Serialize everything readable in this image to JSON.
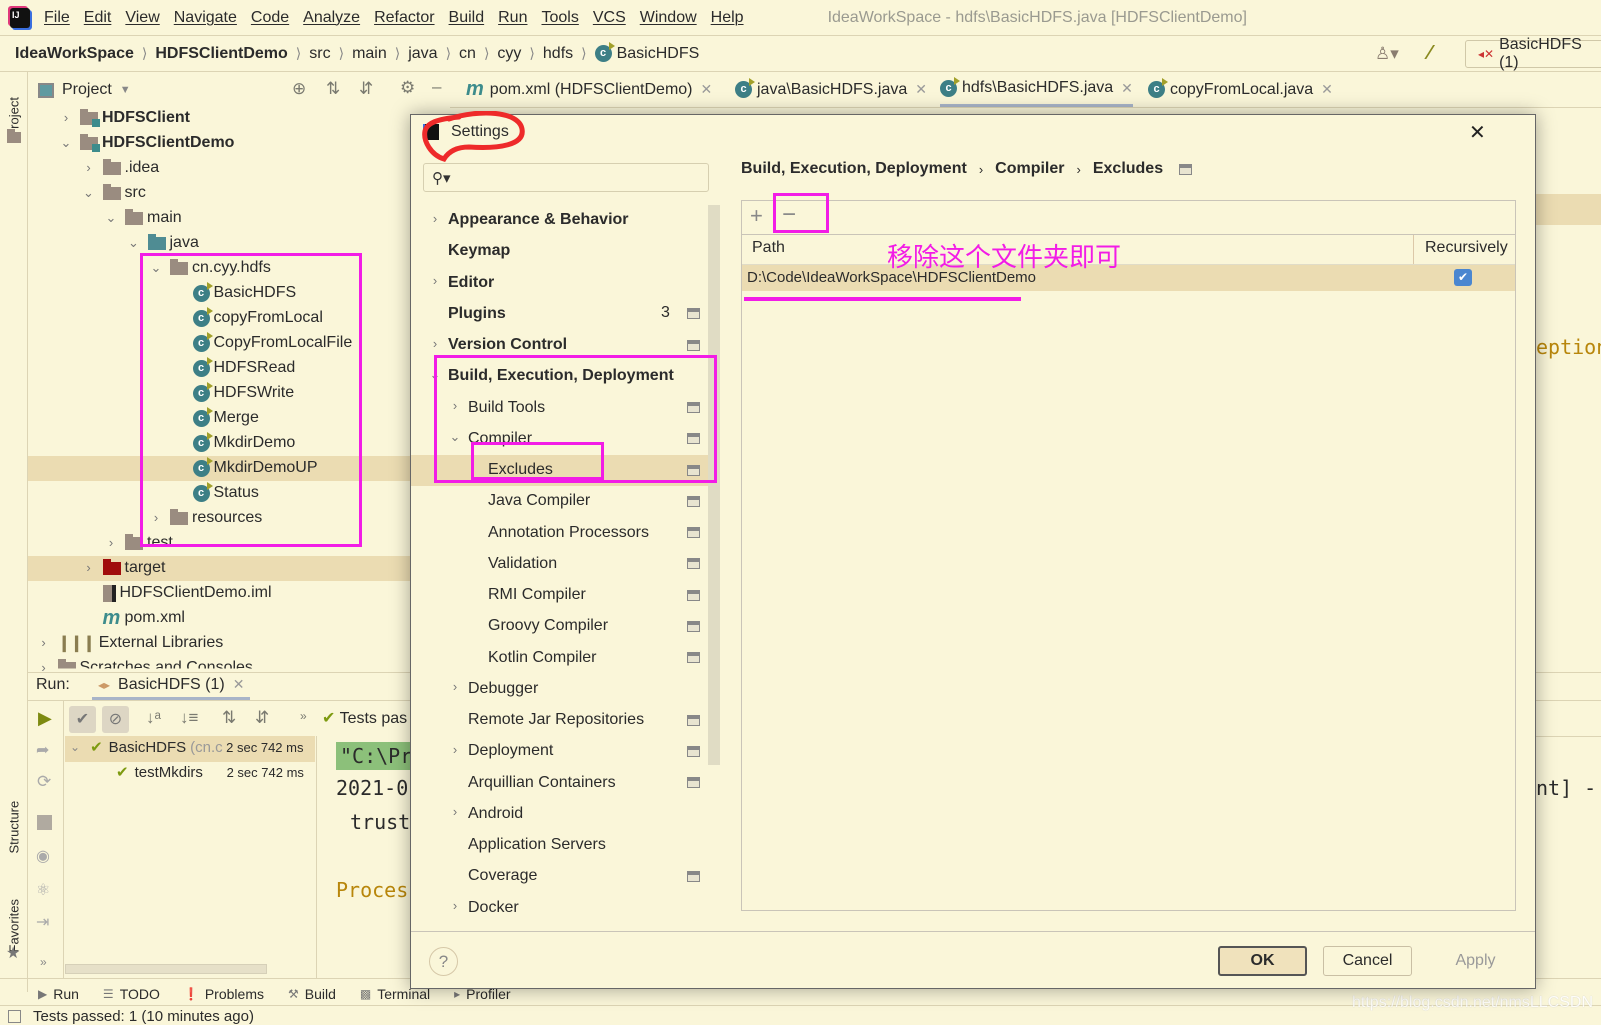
{
  "menubar": {
    "items": [
      "File",
      "Edit",
      "View",
      "Navigate",
      "Code",
      "Analyze",
      "Refactor",
      "Build",
      "Run",
      "Tools",
      "VCS",
      "Window",
      "Help"
    ],
    "window_title": "IdeaWorkSpace - hdfs\\BasicHDFS.java [HDFSClientDemo]"
  },
  "breadcrumb": {
    "items": [
      "IdeaWorkSpace",
      "HDFSClientDemo",
      "src",
      "main",
      "java",
      "cn",
      "cyy",
      "hdfs",
      "BasicHDFS"
    ],
    "run_config": "BasicHDFS (1)"
  },
  "side_stripe": {
    "project": "Project",
    "structure": "Structure",
    "favorites": "Favorites"
  },
  "project_panel": {
    "title": "Project",
    "tree": [
      {
        "label": "HDFSClient",
        "depth": 0,
        "arrow": "right",
        "icon": "module-folder",
        "bold": true
      },
      {
        "label": "HDFSClientDemo",
        "depth": 0,
        "arrow": "down",
        "icon": "module-folder",
        "bold": true
      },
      {
        "label": ".idea",
        "depth": 1,
        "arrow": "right",
        "icon": "folder"
      },
      {
        "label": "src",
        "depth": 1,
        "arrow": "down",
        "icon": "folder"
      },
      {
        "label": "main",
        "depth": 2,
        "arrow": "down",
        "icon": "folder"
      },
      {
        "label": "java",
        "depth": 3,
        "arrow": "down",
        "icon": "source-folder"
      },
      {
        "label": "cn.cyy.hdfs",
        "depth": 4,
        "arrow": "down",
        "icon": "package"
      },
      {
        "label": "BasicHDFS",
        "depth": 5,
        "arrow": "none",
        "icon": "class"
      },
      {
        "label": "copyFromLocal",
        "depth": 5,
        "arrow": "none",
        "icon": "class"
      },
      {
        "label": "CopyFromLocalFile",
        "depth": 5,
        "arrow": "none",
        "icon": "class"
      },
      {
        "label": "HDFSRead",
        "depth": 5,
        "arrow": "none",
        "icon": "class"
      },
      {
        "label": "HDFSWrite",
        "depth": 5,
        "arrow": "none",
        "icon": "class"
      },
      {
        "label": "Merge",
        "depth": 5,
        "arrow": "none",
        "icon": "class"
      },
      {
        "label": "MkdirDemo",
        "depth": 5,
        "arrow": "none",
        "icon": "class"
      },
      {
        "label": "MkdirDemoUP",
        "depth": 5,
        "arrow": "none",
        "icon": "class",
        "selected": true
      },
      {
        "label": "Status",
        "depth": 5,
        "arrow": "none",
        "icon": "class"
      },
      {
        "label": "resources",
        "depth": 4,
        "arrow": "right",
        "icon": "resources-folder"
      },
      {
        "label": "test",
        "depth": 2,
        "arrow": "right",
        "icon": "folder"
      },
      {
        "label": "target",
        "depth": 1,
        "arrow": "right",
        "icon": "excluded-folder",
        "selected": true
      },
      {
        "label": "HDFSClientDemo.iml",
        "depth": 1,
        "arrow": "none",
        "icon": "iml-file"
      },
      {
        "label": "pom.xml",
        "depth": 1,
        "arrow": "none",
        "icon": "maven-file"
      },
      {
        "label": "External Libraries",
        "depth": -1,
        "arrow": "right",
        "icon": "library"
      },
      {
        "label": "Scratches and Consoles",
        "depth": -1,
        "arrow": "right",
        "icon": "scratches"
      }
    ]
  },
  "editor_tabs": [
    {
      "label": "pom.xml (HDFSClientDemo)",
      "icon": "maven"
    },
    {
      "label": "java\\BasicHDFS.java",
      "icon": "class"
    },
    {
      "label": "hdfs\\BasicHDFS.java",
      "icon": "class",
      "active": true
    },
    {
      "label": "copyFromLocal.java",
      "icon": "class"
    }
  ],
  "editor_fragments": {
    "line1": "eption",
    "line2": "nt] -"
  },
  "run_panel": {
    "label": "Run:",
    "tab": "BasicHDFS (1)",
    "status": "Tests pas",
    "tests": [
      {
        "name": "BasicHDFS",
        "suffix": "(cn.c",
        "time": "2 sec 742 ms"
      },
      {
        "name": "testMkdirs",
        "time": "2 sec 742 ms"
      }
    ],
    "console": [
      "\"C:\\Pr",
      "2021-0",
      "trust",
      "Proces"
    ]
  },
  "bottom_tools": [
    "Run",
    "TODO",
    "Problems",
    "Build",
    "Terminal",
    "Profiler"
  ],
  "status_bar": "Tests passed: 1 (10 minutes ago)",
  "watermark": "https://blog.csdn.net/nmsLLCSDN",
  "dialog": {
    "title": "Settings",
    "search_placeholder": "",
    "tree": [
      {
        "label": "Appearance & Behavior",
        "depth": 0,
        "arrow": "right",
        "bold": true
      },
      {
        "label": "Keymap",
        "depth": 0,
        "arrow": "none",
        "bold": true
      },
      {
        "label": "Editor",
        "depth": 0,
        "arrow": "right",
        "bold": true
      },
      {
        "label": "Plugins",
        "depth": 0,
        "arrow": "none",
        "bold": true,
        "badge": "3",
        "project_icon": true
      },
      {
        "label": "Version Control",
        "depth": 0,
        "arrow": "right",
        "bold": true,
        "project_icon": true
      },
      {
        "label": "Build, Execution, Deployment",
        "depth": 0,
        "arrow": "down",
        "bold": true
      },
      {
        "label": "Build Tools",
        "depth": 1,
        "arrow": "right",
        "project_icon": true
      },
      {
        "label": "Compiler",
        "depth": 1,
        "arrow": "down",
        "project_icon": true
      },
      {
        "label": "Excludes",
        "depth": 2,
        "arrow": "none",
        "project_icon": true,
        "selected": true
      },
      {
        "label": "Java Compiler",
        "depth": 2,
        "arrow": "none",
        "project_icon": true
      },
      {
        "label": "Annotation Processors",
        "depth": 2,
        "arrow": "none",
        "project_icon": true
      },
      {
        "label": "Validation",
        "depth": 2,
        "arrow": "none",
        "project_icon": true
      },
      {
        "label": "RMI Compiler",
        "depth": 2,
        "arrow": "none",
        "project_icon": true
      },
      {
        "label": "Groovy Compiler",
        "depth": 2,
        "arrow": "none",
        "project_icon": true
      },
      {
        "label": "Kotlin Compiler",
        "depth": 2,
        "arrow": "none",
        "project_icon": true
      },
      {
        "label": "Debugger",
        "depth": 1,
        "arrow": "right"
      },
      {
        "label": "Remote Jar Repositories",
        "depth": 1,
        "arrow": "none",
        "project_icon": true
      },
      {
        "label": "Deployment",
        "depth": 1,
        "arrow": "right",
        "project_icon": true
      },
      {
        "label": "Arquillian Containers",
        "depth": 1,
        "arrow": "none",
        "project_icon": true
      },
      {
        "label": "Android",
        "depth": 1,
        "arrow": "right"
      },
      {
        "label": "Application Servers",
        "depth": 1,
        "arrow": "none"
      },
      {
        "label": "Coverage",
        "depth": 1,
        "arrow": "none",
        "project_icon": true
      },
      {
        "label": "Docker",
        "depth": 1,
        "arrow": "right"
      }
    ],
    "breadcrumb": [
      "Build, Execution, Deployment",
      "Compiler",
      "Excludes"
    ],
    "table": {
      "columns": [
        "Path",
        "Recursively"
      ],
      "rows": [
        {
          "path": "D:\\Code\\IdeaWorkSpace\\HDFSClientDemo",
          "recursively": true
        }
      ]
    },
    "annotation": "移除这个文件夹即可",
    "buttons": {
      "ok": "OK",
      "cancel": "Cancel",
      "apply": "Apply",
      "help": "?"
    }
  },
  "colors": {
    "background": "#faf6d9",
    "selection": "#ebdcb2",
    "annotation": "#f21ce6",
    "circle": "#ee2a2a",
    "checkbox": "#4a86d0"
  }
}
